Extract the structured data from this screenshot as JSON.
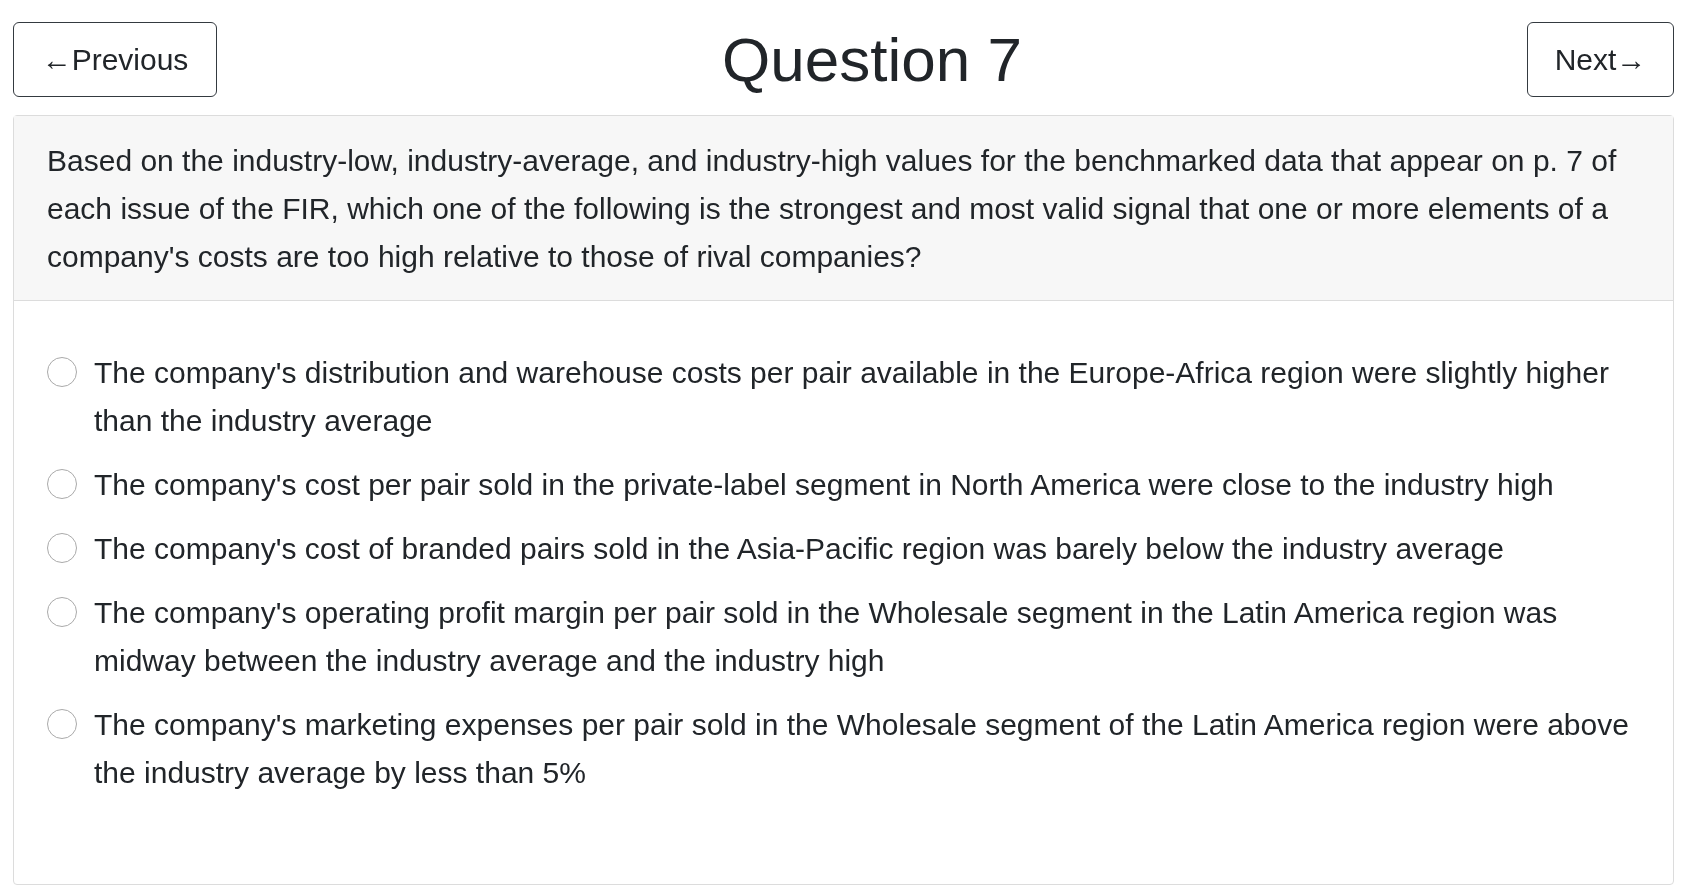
{
  "nav": {
    "previous": "←Previous",
    "title": "Question 7",
    "next": "Next→"
  },
  "question": "Based on the industry-low, industry-average, and industry-high values for the benchmarked data that appear on p. 7 of each issue of the FIR, which one of the following is the strongest and most valid signal that one or more elements of a company's costs are too high relative to those of rival companies?",
  "options": [
    {
      "label": "The company's distribution and warehouse costs per pair available in the Europe-Africa region were slightly higher than the industry average",
      "selected": false
    },
    {
      "label": "The company's cost per pair sold in the private-label segment in North America were close to the industry high",
      "selected": false
    },
    {
      "label": "The company's cost of branded pairs sold in the Asia-Pacific region was barely below the industry average",
      "selected": false
    },
    {
      "label": "The company's operating profit margin per pair sold in the Wholesale segment in the Latin America region was midway between the industry average and the industry high",
      "selected": false
    },
    {
      "label": "The company's marketing expenses per pair sold in the Wholesale segment of the Latin America region were above the industry average by less than 5%",
      "selected": false
    }
  ]
}
